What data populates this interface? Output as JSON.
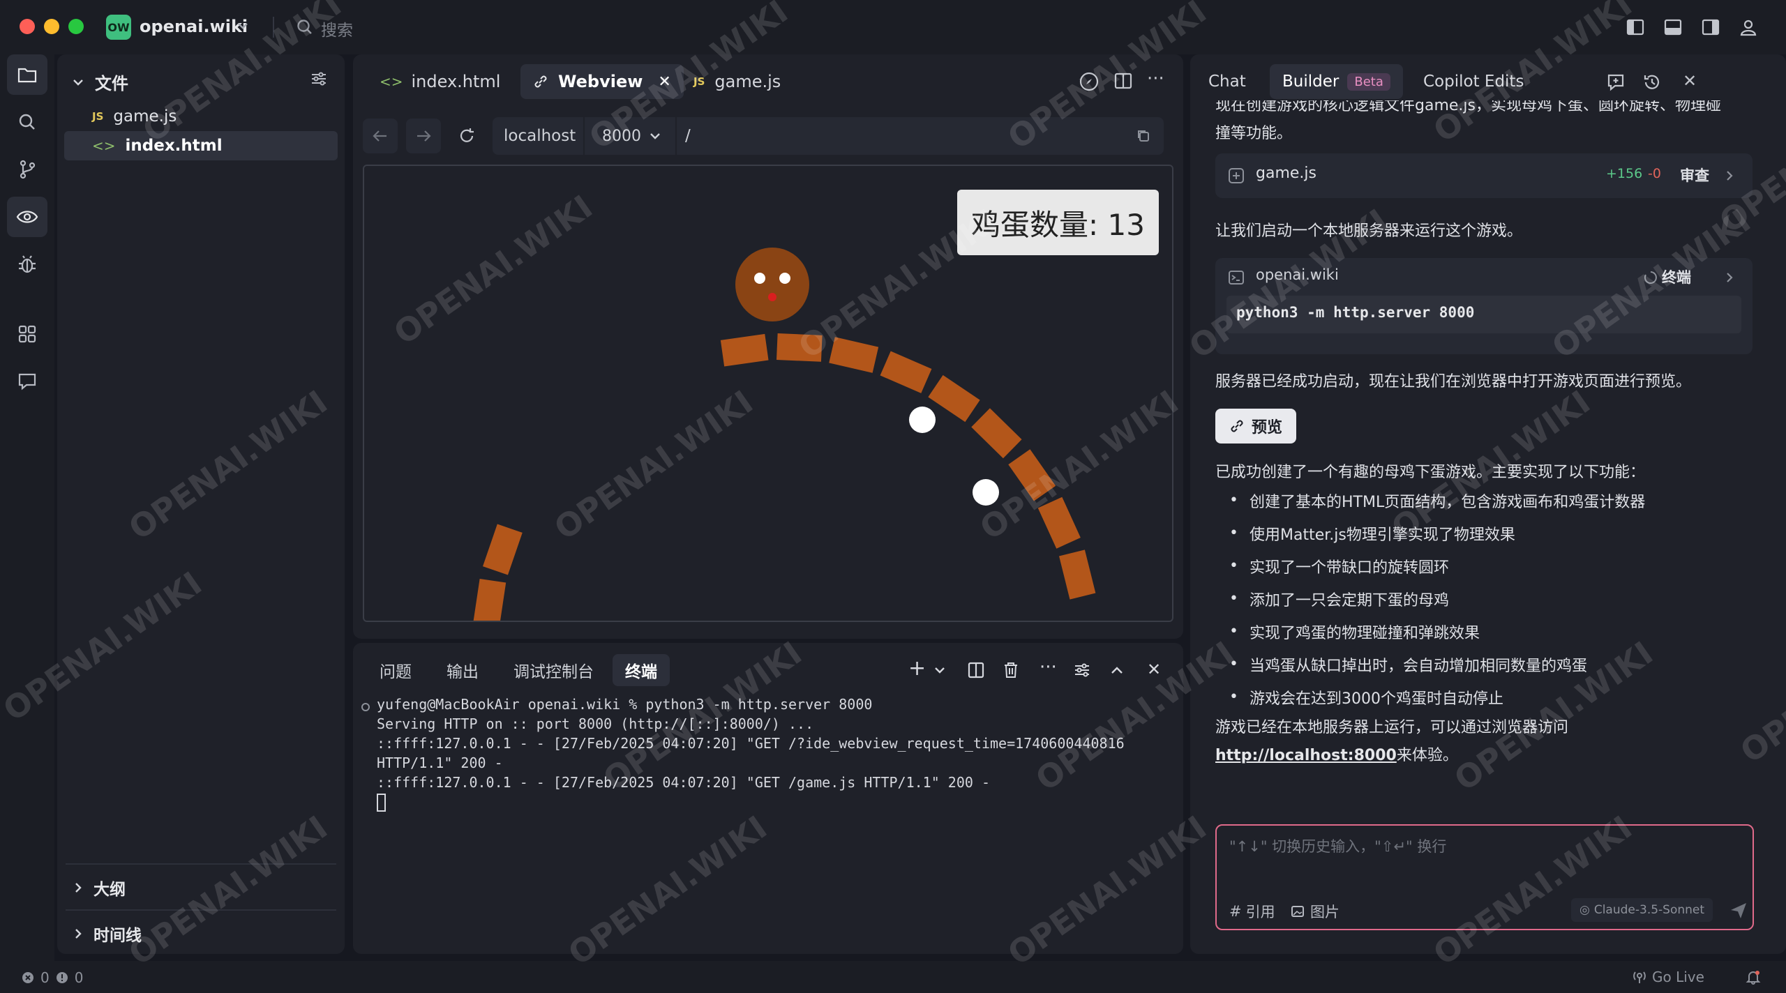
{
  "window": {
    "workspace_badge": "OW",
    "workspace_name": "openai.wiki",
    "search_placeholder": "搜索"
  },
  "explorer": {
    "section_files": "文件",
    "files": [
      {
        "type": "JS",
        "name": "game.js"
      },
      {
        "type": "html",
        "name": "index.html"
      }
    ],
    "section_outline": "大纲",
    "section_timeline": "时间线"
  },
  "editor": {
    "tabs": [
      {
        "name": "index.html"
      },
      {
        "name": "Webview"
      },
      {
        "type": "JS",
        "name": "game.js"
      }
    ],
    "url": {
      "host": "localhost",
      "port": "8000",
      "path": "/"
    },
    "game": {
      "counter_label": "鸡蛋数量: 13",
      "ring_color": "#b3561a",
      "hen_color": "#8a4414",
      "egg_count": 13
    }
  },
  "bottom_panel": {
    "tabs": [
      "问题",
      "输出",
      "调试控制台",
      "终端"
    ],
    "active_tab": "终端",
    "terminal_lines": [
      "yufeng@MacBookAir openai.wiki % python3 -m http.server 8000",
      "Serving HTTP on :: port 8000 (http://[::]:8000/) ...",
      "::ffff:127.0.0.1 - - [27/Feb/2025 04:07:20] \"GET /?ide_webview_request_time=1740600440816",
      "HTTP/1.1\" 200 -",
      "::ffff:127.0.0.1 - - [27/Feb/2025 04:07:20] \"GET /game.js HTTP/1.1\" 200 -"
    ]
  },
  "chat": {
    "tabs": {
      "chat": "Chat",
      "builder": "Builder",
      "beta": "Beta",
      "copilot": "Copilot Edits"
    },
    "intro_line1": "现在创建游戏的核心逻辑文件game.js，实现母鸡下蛋、圆环旋转、物理碰",
    "intro_line2": "撞等功能。",
    "file_card": {
      "name": "game.js",
      "added": "+156",
      "removed": "-0",
      "action": "审查"
    },
    "run_text": "让我们启动一个本地服务器来运行这个游戏。",
    "terminal_card": {
      "title": "openai.wiki",
      "label": "终端",
      "command": "python3 -m http.server 8000"
    },
    "server_text": "服务器已经成功启动，现在让我们在浏览器中打开游戏页面进行预览。",
    "preview_button": "预览",
    "summary_intro": "已成功创建了一个有趣的母鸡下蛋游戏。主要实现了以下功能：",
    "features": [
      "创建了基本的HTML页面结构，包含游戏画布和鸡蛋计数器",
      "使用Matter.js物理引擎实现了物理效果",
      "实现了一个带缺口的旋转圆环",
      "添加了一只会定期下蛋的母鸡",
      "实现了鸡蛋的物理碰撞和弹跳效果",
      "当鸡蛋从缺口掉出时，会自动增加相同数量的鸡蛋",
      "游戏会在达到3000个鸡蛋时自动停止"
    ],
    "closing_line1": "游戏已经在本地服务器上运行，可以通过浏览器访问",
    "closing_link": "http://localhost:8000",
    "closing_suffix": "来体验。",
    "input_placeholder": "\"↑↓\" 切换历史输入，\"⇧↵\" 换行",
    "input_ref": "引用",
    "input_image": "图片",
    "model": "Claude-3.5-Sonnet"
  },
  "status": {
    "errors": "0",
    "warnings": "0",
    "golive": "Go Live"
  },
  "watermark": "OPENAI.WIKI"
}
